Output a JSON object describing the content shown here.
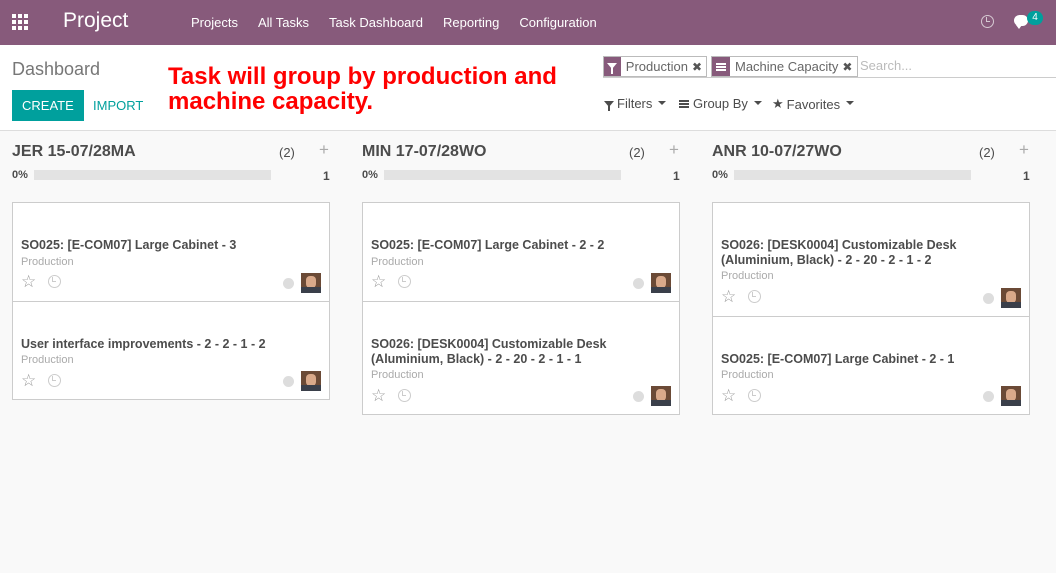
{
  "app": {
    "title": "Project",
    "nav": [
      "Projects",
      "All Tasks",
      "Task Dashboard",
      "Reporting",
      "Configuration"
    ],
    "messages_badge": "4"
  },
  "control_panel": {
    "title": "Dashboard",
    "annotation": "Task will group by production and machine capacity.",
    "create_label": "CREATE",
    "import_label": "IMPORT",
    "facets": [
      "Production",
      "Machine Capacity"
    ],
    "search_placeholder": "Search...",
    "filters_label": "Filters",
    "groupby_label": "Group By",
    "favorites_label": "Favorites"
  },
  "columns": [
    {
      "title": "JER 15-07/28MA",
      "count": "(2)",
      "percent": "0%",
      "progress": 0,
      "total": "1",
      "cards": [
        {
          "title": "SO025: [E-COM07] Large Cabinet - 3",
          "tag": "Production"
        },
        {
          "title": "User interface improvements - 2 - 2 - 1 - 2",
          "tag": "Production"
        }
      ]
    },
    {
      "title": "MIN 17-07/28WO",
      "count": "(2)",
      "percent": "0%",
      "progress": 0,
      "total": "1",
      "cards": [
        {
          "title": "SO025: [E-COM07] Large Cabinet - 2 - 2",
          "tag": "Production"
        },
        {
          "title": "SO026: [DESK0004] Customizable Desk (Aluminium, Black) - 2 - 20 - 2 - 1 - 1",
          "tag": "Production"
        }
      ]
    },
    {
      "title": "ANR 10-07/27WO",
      "count": "(2)",
      "percent": "0%",
      "progress": 0,
      "total": "1",
      "cards": [
        {
          "title": "SO026: [DESK0004] Customizable Desk (Aluminium, Black) - 2 - 20 - 2 - 1 - 2",
          "tag": "Production"
        },
        {
          "title": "SO025: [E-COM07] Large Cabinet - 2 - 1",
          "tag": "Production"
        }
      ]
    }
  ],
  "colors": {
    "brand": "#875a7b",
    "accent": "#00a09d",
    "annotation": "#ff0000"
  }
}
